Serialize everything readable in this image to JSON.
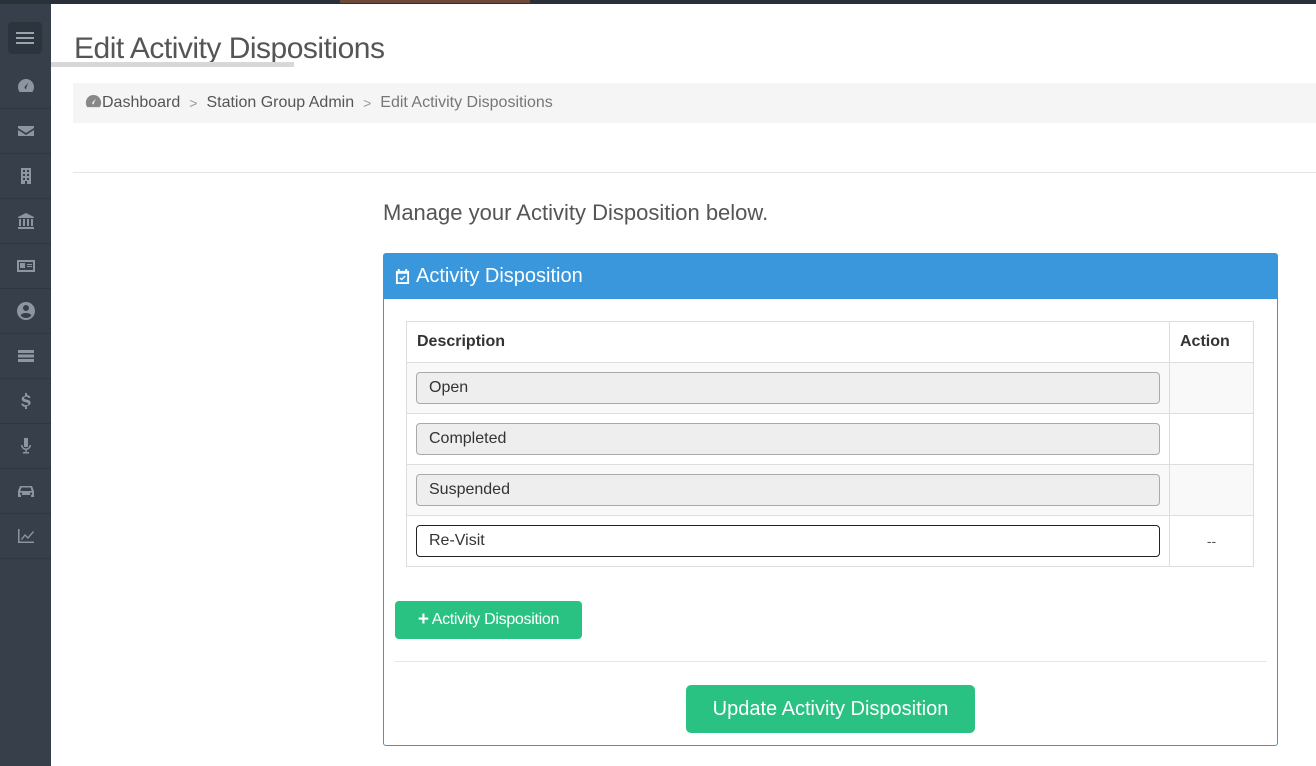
{
  "page": {
    "title": "Edit Activity Dispositions",
    "intro": "Manage your Activity Disposition below."
  },
  "sidebar": {
    "items": [
      {
        "icon": "dashboard-icon"
      },
      {
        "icon": "envelope-icon"
      },
      {
        "icon": "building-icon"
      },
      {
        "icon": "bank-icon"
      },
      {
        "icon": "id-card-icon"
      },
      {
        "icon": "user-circle-icon"
      },
      {
        "icon": "server-icon"
      },
      {
        "icon": "dollar-icon"
      },
      {
        "icon": "microphone-icon"
      },
      {
        "icon": "car-icon"
      },
      {
        "icon": "line-chart-icon"
      }
    ]
  },
  "breadcrumb": {
    "items": [
      "Dashboard",
      "Station Group Admin",
      "Edit Activity Dispositions"
    ],
    "separator": ">"
  },
  "panel": {
    "heading": "Activity Disposition",
    "table": {
      "headers": [
        "Description",
        "Action"
      ],
      "rows": [
        {
          "description": "Open",
          "action": ""
        },
        {
          "description": "Completed",
          "action": ""
        },
        {
          "description": "Suspended",
          "action": ""
        },
        {
          "description": "Re-Visit",
          "action": "--"
        }
      ]
    },
    "add_button_label": "Activity Disposition",
    "add_button_symbol": "+",
    "update_button_label": "Update Activity Disposition"
  },
  "colors": {
    "sidebar": "#37404a",
    "panel_accent": "#3a97db",
    "button_green": "#2ac282"
  }
}
